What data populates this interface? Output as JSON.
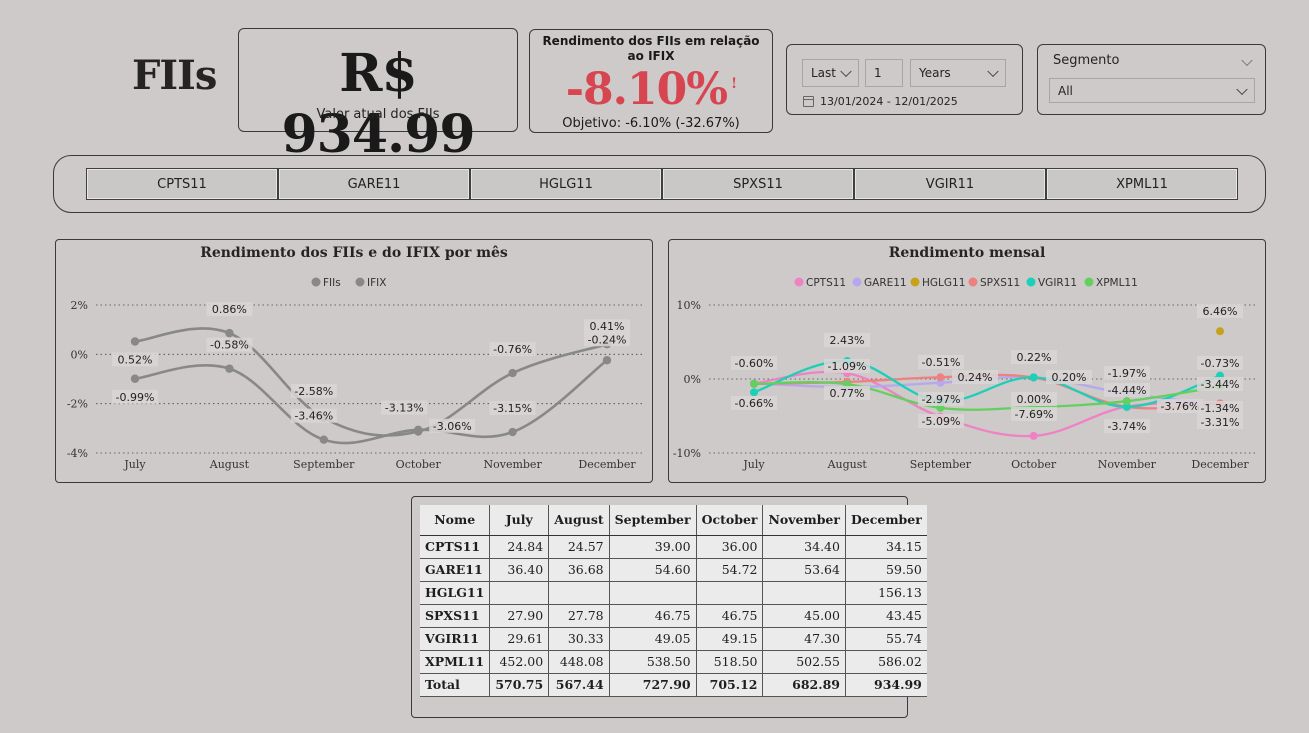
{
  "header": {
    "title": "FIIs",
    "kpi_value": "R$ 934.99",
    "kpi_label": "Valor atual dos FIIs",
    "kpi2_title": "Rendimento dos FIIs em relação ao IFIX",
    "kpi2_value": "-8.10%",
    "kpi2_warning": "!",
    "kpi2_goal": "Objetivo: -6.10% (-32.67%)"
  },
  "date_filter": {
    "mode": "Last",
    "count": "1",
    "unit": "Years",
    "range": "13/01/2024 - 12/01/2025"
  },
  "segment_filter": {
    "label": "Segmento",
    "value": "All"
  },
  "tabs": [
    "CPTS11",
    "GARE11",
    "HGLG11",
    "SPXS11",
    "VGIR11",
    "XPML11"
  ],
  "colors": {
    "fiis": "#e21ee6",
    "ifix": "#ef9a4e",
    "CPTS11": "#ef82c4",
    "GARE11": "#b6a8ef",
    "HGLG11": "#c6a11c",
    "SPXS11": "#ef8080",
    "VGIR11": "#1ccfb9",
    "XPML11": "#63d05e",
    "kpi_negative": "#d64550"
  },
  "chart_data": [
    {
      "type": "line",
      "title": "Rendimento dos FIIs e do IFIX por mês",
      "categories": [
        "July",
        "August",
        "September",
        "October",
        "November",
        "December"
      ],
      "y_ticks": [
        "2%",
        "0%",
        "-2%",
        "-4%"
      ],
      "ylim": [
        -4,
        2
      ],
      "legend_position": "top-center",
      "grid": true,
      "series": [
        {
          "name": "FIIs",
          "values": [
            -0.99,
            -0.58,
            -3.46,
            -3.06,
            -3.15,
            -0.24
          ],
          "labels": [
            "-0.99%",
            "-0.58%",
            "-3.46%",
            "-3.06%",
            "-3.15%",
            "-0.24%"
          ]
        },
        {
          "name": "IFIX",
          "values": [
            0.52,
            0.86,
            -2.58,
            -3.13,
            -0.76,
            0.41
          ],
          "labels": [
            "0.52%",
            "0.86%",
            "-2.58%",
            "-3.13%",
            "-0.76%",
            "0.41%"
          ]
        }
      ]
    },
    {
      "type": "line",
      "title": "Rendimento mensal",
      "categories": [
        "July",
        "August",
        "September",
        "October",
        "November",
        "December"
      ],
      "y_ticks": [
        "10%",
        "0%",
        "-10%"
      ],
      "ylim": [
        -10,
        10
      ],
      "legend_position": "top-center",
      "grid": true,
      "series": [
        {
          "name": "CPTS11",
          "values": [
            -0.6,
            0.77,
            -5.09,
            -7.69,
            -3.74,
            -3.31
          ]
        },
        {
          "name": "GARE11",
          "values": [
            -0.6,
            -1.09,
            -0.51,
            0.22,
            -1.97,
            -3.44
          ]
        },
        {
          "name": "HGLG11",
          "values": [
            null,
            null,
            null,
            null,
            null,
            6.46
          ]
        },
        {
          "name": "SPXS11",
          "values": [
            -0.66,
            -0.4,
            0.24,
            0.2,
            -3.76,
            -3.31
          ]
        },
        {
          "name": "VGIR11",
          "values": [
            -1.8,
            2.43,
            -2.97,
            0.22,
            -3.76,
            0.45
          ]
        },
        {
          "name": "XPML11",
          "values": [
            -0.66,
            -0.7,
            -3.9,
            -3.8,
            -3.0,
            -1.0
          ]
        }
      ],
      "data_labels": [
        "-0.60%",
        "-0.66%",
        "2.43%",
        "-1.09%",
        "0.77%",
        "-0.51%",
        "0.24%",
        "-5.09%",
        "-2.97%",
        "0.22%",
        "0.20%",
        "0.00%",
        "-7.69%",
        "-1.97%",
        "-4.44%",
        "-3.76%",
        "-3.74%",
        "6.46%",
        "-0.73%",
        "-3.44%",
        "-1.34%",
        "-3.31%"
      ]
    }
  ],
  "table": {
    "headers": [
      "Nome",
      "July",
      "August",
      "September",
      "October",
      "November",
      "December"
    ],
    "rows": [
      [
        "CPTS11",
        "24.84",
        "24.57",
        "39.00",
        "36.00",
        "34.40",
        "34.15"
      ],
      [
        "GARE11",
        "36.40",
        "36.68",
        "54.60",
        "54.72",
        "53.64",
        "59.50"
      ],
      [
        "HGLG11",
        "",
        "",
        "",
        "",
        "",
        "156.13"
      ],
      [
        "SPXS11",
        "27.90",
        "27.78",
        "46.75",
        "46.75",
        "45.00",
        "43.45"
      ],
      [
        "VGIR11",
        "29.61",
        "30.33",
        "49.05",
        "49.15",
        "47.30",
        "55.74"
      ],
      [
        "XPML11",
        "452.00",
        "448.08",
        "538.50",
        "518.50",
        "502.55",
        "586.02"
      ]
    ],
    "total": [
      "Total",
      "570.75",
      "567.44",
      "727.90",
      "705.12",
      "682.89",
      "934.99"
    ]
  }
}
